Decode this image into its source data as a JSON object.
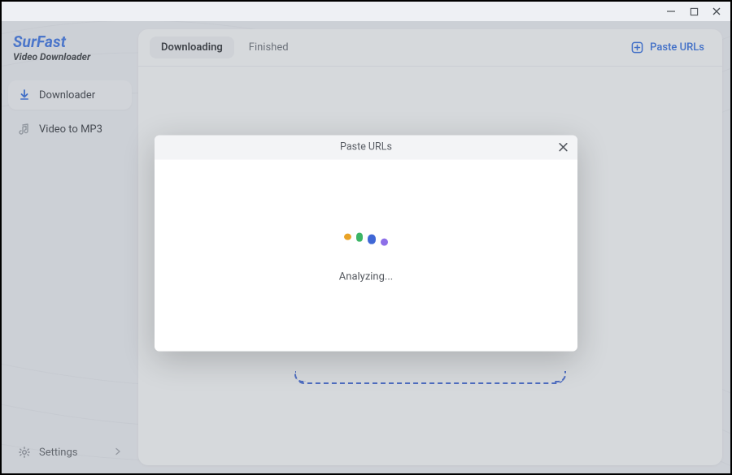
{
  "brand": {
    "line1": "SurFast",
    "line2": "Video Downloader"
  },
  "sidebar": {
    "items": [
      {
        "label": "Downloader"
      },
      {
        "label": "Video to MP3"
      }
    ],
    "settings_label": "Settings"
  },
  "tabs": {
    "downloading": "Downloading",
    "finished": "Finished"
  },
  "paste_button_label": "Paste URLs",
  "modal": {
    "title": "Paste URLs",
    "status": "Analyzing..."
  },
  "colors": {
    "accent": "#3b73e4",
    "loader": [
      "#e9a327",
      "#3cb566",
      "#3f67d6",
      "#8d6fe8"
    ]
  }
}
